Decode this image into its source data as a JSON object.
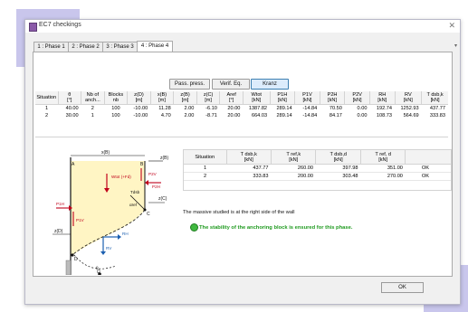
{
  "window": {
    "title": "EC7 checkings",
    "close_glyph": "✕"
  },
  "tabs": [
    {
      "label": "1 : Phase 1",
      "active": false
    },
    {
      "label": "2 : Phase 2",
      "active": false
    },
    {
      "label": "3 : Phase 3",
      "active": false
    },
    {
      "label": "4 : Phase 4",
      "active": true
    }
  ],
  "toolbar": {
    "pass_press": "Pass. press.",
    "verif_eq": "Verif. Eq.",
    "kranz": "Kranz"
  },
  "table1": {
    "headers": [
      [
        "Situation",
        ""
      ],
      [
        "θ",
        "[°]"
      ],
      [
        "Nb of",
        "anch..."
      ],
      [
        "Blocks",
        "nb"
      ],
      [
        "z(D)",
        "[m]"
      ],
      [
        "x(B)",
        "[m]"
      ],
      [
        "z(B)",
        "[m]"
      ],
      [
        "z(C)",
        "[m]"
      ],
      [
        "Aref",
        "[°]"
      ],
      [
        "Wtot",
        "[kN]"
      ],
      [
        "P1H",
        "[kN]"
      ],
      [
        "P1V",
        "[kN]"
      ],
      [
        "P2H",
        "[kN]"
      ],
      [
        "P2V",
        "[kN]"
      ],
      [
        "RH",
        "[kN]"
      ],
      [
        "RV",
        "[kN]"
      ],
      [
        "T dsb,k",
        "[kN]"
      ]
    ],
    "rows": [
      [
        "1",
        "40.00",
        "2",
        "100",
        "-10.00",
        "11.28",
        "2.00",
        "-6.10",
        "20.00",
        "1387.82",
        "289.14",
        "-14.84",
        "70.50",
        "0.00",
        "192.74",
        "1252.93",
        "437.77"
      ],
      [
        "2",
        "30.00",
        "1",
        "100",
        "-10.00",
        "4.70",
        "2.00",
        "-8.71",
        "20.00",
        "664.03",
        "289.14",
        "-14.84",
        "84.17",
        "0.00",
        "108.73",
        "564.69",
        "333.83"
      ]
    ]
  },
  "table2": {
    "headers": [
      [
        "Situation",
        ""
      ],
      [
        "T dsb,k",
        "[kN]"
      ],
      [
        "T ref,k",
        "[kN]"
      ],
      [
        "T dsb,d",
        "[kN]"
      ],
      [
        "T ref, d",
        "[kN]"
      ],
      [
        "",
        ""
      ]
    ],
    "rows": [
      [
        "1",
        "437.77",
        "260.00",
        "397.98",
        "351.00",
        "OK"
      ],
      [
        "2",
        "333.83",
        "200.00",
        "303.48",
        "270.00",
        "OK"
      ]
    ]
  },
  "messages": {
    "massive": "The massive studied is at the right side of the wall",
    "stability": "The stability of the anchoring block is ensured for this phase."
  },
  "diagram": {
    "xB": "x(B)",
    "A": "A",
    "B": "B",
    "zB": "z(B)",
    "zC": "z(C)",
    "zD": "z(D)",
    "wtot": "Wtot (+Fd)",
    "P1V": "P1V",
    "P2V": "P2V",
    "P1H": "P1H",
    "P2H": "P2H",
    "Tdsb": "Tdsb",
    "alpha": "αref",
    "RH": "RH",
    "RV": "RV",
    "C": "C",
    "D": "D",
    "Omega": "Ω",
    "theta": "θ"
  },
  "footer": {
    "ok": "OK"
  },
  "colors": {
    "soil": "#fff5c4",
    "accent": "#3c7fb1",
    "ok_green": "#1f9a1f",
    "force_red": "#c0001a",
    "force_blue": "#1b5fb0"
  }
}
